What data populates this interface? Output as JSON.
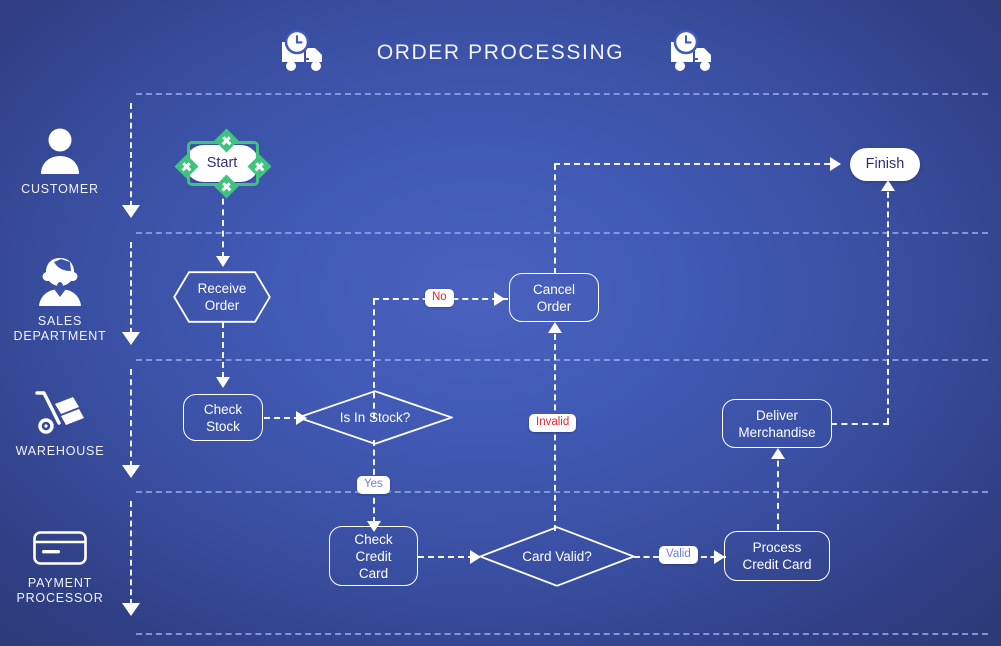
{
  "header": {
    "title": "ORDER PROCESSING",
    "left_icon": "delivery-truck-clock-icon",
    "right_icon": "delivery-truck-clock-icon"
  },
  "theme": {
    "background_dark": "#2d3e80",
    "background_light": "#4a62bd",
    "node_stroke": "#ffffff",
    "selection_green": "#3fc47f",
    "label_red": "#e8262d",
    "label_blue": "#6d7fd6",
    "lane_divider": "#8fa3e8",
    "terminator_text": "#2d3172"
  },
  "swimlanes": [
    {
      "id": "customer",
      "label": "CUSTOMER",
      "icon": "person-icon"
    },
    {
      "id": "sales",
      "label": "SALES\nDEPARTMENT",
      "icon": "headset-operator-icon"
    },
    {
      "id": "warehouse",
      "label": "WAREHOUSE",
      "icon": "hand-truck-icon"
    },
    {
      "id": "payment",
      "label": "PAYMENT\nPROCESSOR",
      "icon": "credit-card-icon"
    }
  ],
  "nodes": [
    {
      "id": "start",
      "label": "Start",
      "shape": "terminator",
      "lane": "customer",
      "selected": true
    },
    {
      "id": "receive_order",
      "label": "Receive\nOrder",
      "shape": "hexagon",
      "lane": "sales",
      "selected": false
    },
    {
      "id": "check_stock",
      "label": "Check\nStock",
      "shape": "rounded",
      "lane": "warehouse",
      "selected": false
    },
    {
      "id": "is_in_stock",
      "label": "Is In Stock?",
      "shape": "diamond",
      "lane": "warehouse",
      "selected": false
    },
    {
      "id": "cancel_order",
      "label": "Cancel\nOrder",
      "shape": "rounded",
      "lane": "sales",
      "selected": false
    },
    {
      "id": "check_credit",
      "label": "Check\nCredit\nCard",
      "shape": "rounded",
      "lane": "payment",
      "selected": false
    },
    {
      "id": "card_valid",
      "label": "Card Valid?",
      "shape": "diamond",
      "lane": "payment",
      "selected": false
    },
    {
      "id": "process_credit",
      "label": "Process\nCredit Card",
      "shape": "rounded",
      "lane": "payment",
      "selected": false
    },
    {
      "id": "deliver",
      "label": "Deliver\nMerchandise",
      "shape": "rounded",
      "lane": "warehouse",
      "selected": false
    },
    {
      "id": "finish",
      "label": "Finish",
      "shape": "terminator",
      "lane": "customer",
      "selected": false
    }
  ],
  "edges": [
    {
      "from": "start",
      "to": "receive_order",
      "label": ""
    },
    {
      "from": "receive_order",
      "to": "check_stock",
      "label": ""
    },
    {
      "from": "check_stock",
      "to": "is_in_stock",
      "label": ""
    },
    {
      "from": "is_in_stock",
      "to": "cancel_order",
      "label": "No",
      "label_color": "red"
    },
    {
      "from": "is_in_stock",
      "to": "check_credit",
      "label": "Yes",
      "label_color": "blue"
    },
    {
      "from": "check_credit",
      "to": "card_valid",
      "label": ""
    },
    {
      "from": "card_valid",
      "to": "cancel_order",
      "label": "Invalid",
      "label_color": "red"
    },
    {
      "from": "card_valid",
      "to": "process_credit",
      "label": "Valid",
      "label_color": "blue"
    },
    {
      "from": "process_credit",
      "to": "deliver",
      "label": ""
    },
    {
      "from": "deliver",
      "to": "finish",
      "label": ""
    },
    {
      "from": "cancel_order",
      "to": "finish",
      "label": ""
    }
  ],
  "edge_labels": {
    "no": "No",
    "yes": "Yes",
    "invalid": "Invalid",
    "valid": "Valid"
  }
}
